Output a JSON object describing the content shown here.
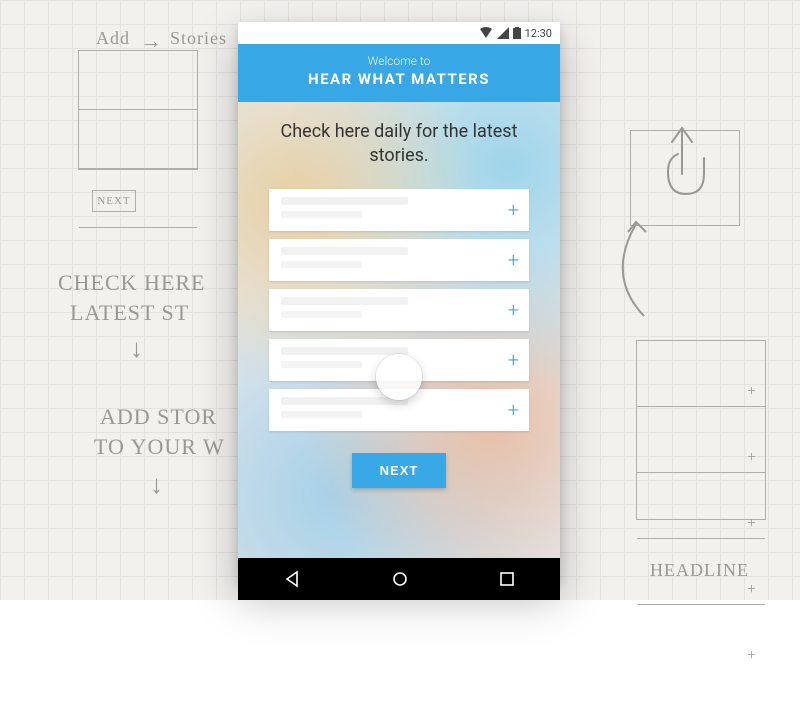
{
  "statusbar": {
    "time": "12:30"
  },
  "header": {
    "welcome": "Welcome to",
    "title": "HEAR WHAT MATTERS"
  },
  "prompt": "Check here daily for the latest stories.",
  "cards": [
    {
      "add_glyph": "+"
    },
    {
      "add_glyph": "+"
    },
    {
      "add_glyph": "+"
    },
    {
      "add_glyph": "+"
    },
    {
      "add_glyph": "+"
    }
  ],
  "next_label": "NEXT",
  "sketch": {
    "add_label": "Add",
    "stories_label": "Stories",
    "next_box": "NEXT",
    "check_here": "CHECK HERE",
    "latest_st": "LATEST ST",
    "add_stor": "ADD STOR",
    "to_your": "TO YOUR W",
    "headline": "HEADLINE",
    "right_box_rows": [
      "+",
      "+",
      "+",
      "+",
      "+"
    ]
  },
  "colors": {
    "accent": "#37a7e6"
  }
}
